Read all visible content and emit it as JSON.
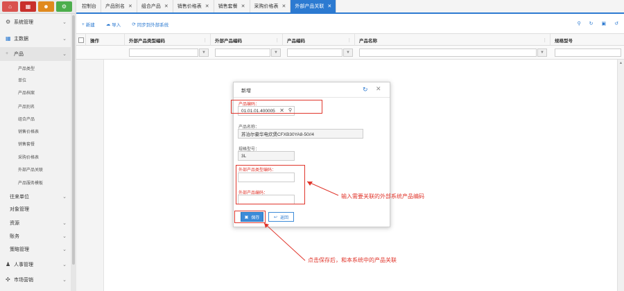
{
  "sidebar": {
    "main_items": [
      {
        "label": "系统管理"
      },
      {
        "label": "主数据"
      },
      {
        "label": "产品"
      }
    ],
    "sub_items": [
      {
        "label": "产品类型"
      },
      {
        "label": "单位"
      },
      {
        "label": "产品档案"
      },
      {
        "label": "产品别名"
      },
      {
        "label": "组合产品"
      },
      {
        "label": "销售价格表"
      },
      {
        "label": "销售套餐"
      },
      {
        "label": "采购价格表"
      },
      {
        "label": "外部产品关联"
      },
      {
        "label": "产品服务模板"
      }
    ],
    "lower_items": [
      {
        "label": "往来单位"
      },
      {
        "label": "对象管理"
      },
      {
        "label": "资源"
      },
      {
        "label": "账务"
      },
      {
        "label": "策略管理"
      }
    ],
    "bottom_items": [
      {
        "label": "人事管理"
      },
      {
        "label": "市场营销"
      }
    ],
    "top_icon_colors": [
      "#d9534f",
      "#c9302c",
      "#e08a1e",
      "#4cae4c"
    ]
  },
  "tabs": [
    {
      "label": "控制台",
      "closable": false
    },
    {
      "label": "产品别名",
      "closable": true
    },
    {
      "label": "组合产品",
      "closable": true
    },
    {
      "label": "销售价格表",
      "closable": true
    },
    {
      "label": "销售套餐",
      "closable": true
    },
    {
      "label": "采购价格表",
      "closable": true
    },
    {
      "label": "外部产品关联",
      "closable": true
    }
  ],
  "toolbar": {
    "create_label": "新建",
    "import_label": "导入",
    "sync_label": "同步到外部系统"
  },
  "grid": {
    "columns": [
      {
        "label": "操作"
      },
      {
        "label": "外部产品类型编码"
      },
      {
        "label": "外部产品编码"
      },
      {
        "label": "产品编码"
      },
      {
        "label": "产品名称"
      },
      {
        "label": "规格型号"
      }
    ]
  },
  "modal": {
    "title": "新增",
    "product_code_label": "产品编码：",
    "product_code_value": "01.01.01.400005",
    "product_name_label": "产品名称：",
    "product_name_value": "苏泊尔豪华电炊煲CFXB30YA8-50//4",
    "spec_label": "规格型号：",
    "spec_value": "3L",
    "ext_type_code_label": "外部产品类型编码：",
    "ext_type_code_value": "",
    "ext_code_label": "外部产品编码：",
    "ext_code_value": "",
    "save_label": "保存",
    "back_label": "返回"
  },
  "annotations": {
    "input_hint": "输入需要关联的外部系统产品编码",
    "save_hint": "点击保存后，和本系统中的产品关联"
  },
  "colors": {
    "accent": "#2c7ad1",
    "annotation_red": "#e0352b"
  }
}
